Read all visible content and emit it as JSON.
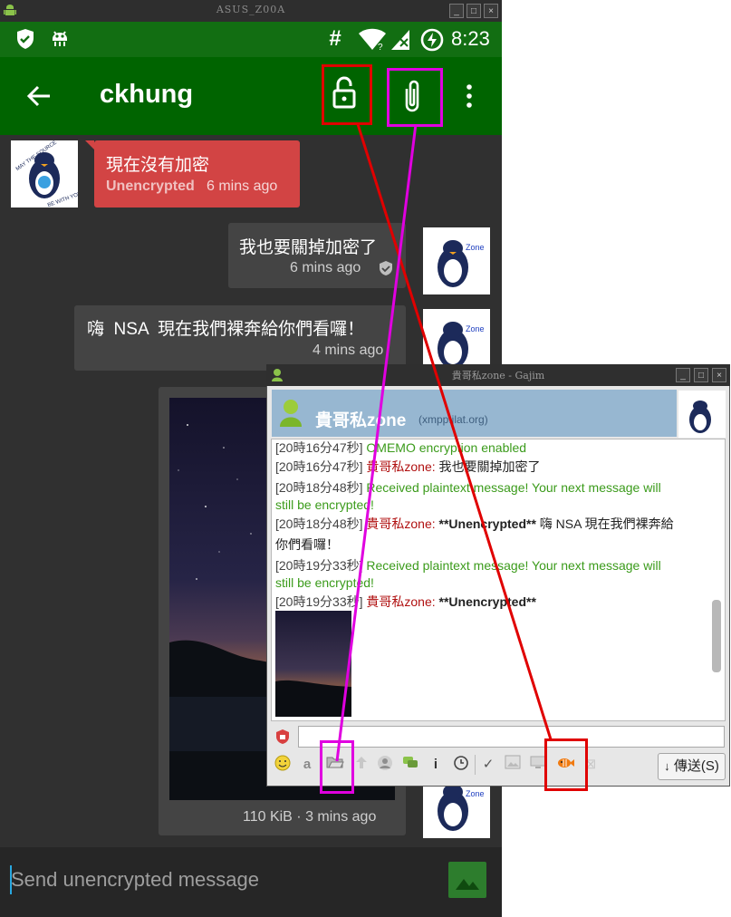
{
  "emulator": {
    "window_title": "ASUS_Z00A",
    "status_time": "8:23",
    "status_icons": [
      "shield-icon",
      "android-debug-icon",
      "hash-icon",
      "wifi-icon",
      "no-sim-icon",
      "battery-saver-icon"
    ]
  },
  "conversations": {
    "contact_name": "ckhung",
    "toolbar": [
      "back-arrow-icon",
      "lock-open-icon",
      "paperclip-icon",
      "overflow-menu-icon"
    ],
    "messages": [
      {
        "side": "left",
        "text": "現在沒有加密",
        "status": "Unencrypted",
        "time": "6 mins ago"
      },
      {
        "side": "right",
        "text": "我也要關掉加密了",
        "time": "6 mins ago"
      },
      {
        "side": "left",
        "text": "嗨  NSA  現在我們裸奔給你們看囉！",
        "time": "4 mins ago"
      },
      {
        "side": "left",
        "type": "image",
        "size_time": "110 KiB · 3 mins ago"
      }
    ],
    "input_placeholder": "Send unencrypted message"
  },
  "gajim": {
    "window_title": "貴哥私zone - Gajim",
    "contact_name": "貴哥私zone",
    "contact_jid": "(xmpp.jlat.org)",
    "log": [
      {
        "ts": "[20時16分47秒]",
        "info": "OMEMO encryption enabled"
      },
      {
        "ts": "[20時16分47秒]",
        "nick": "貴哥私zone:",
        "text": "我也要關掉加密了"
      },
      {
        "ts": "[20時18分48秒]",
        "info": "Received plaintext message! Your next message will",
        "info2": "still be encrypted!"
      },
      {
        "ts": "[20時18分48秒]",
        "nick": "貴哥私zone:",
        "bold": "**Unencrypted**",
        "text": "嗨  NSA  現在我們裸奔給",
        "text2": "你們看囉！"
      },
      {
        "ts": "[20時19分33秒]",
        "info": "Received plaintext message! Your next message will",
        "info2": "still be encrypted!"
      },
      {
        "ts": "[20時19分33秒]",
        "nick": "貴哥私zone:",
        "bold": "**Unencrypted**"
      }
    ],
    "send_button": "傳送(S)",
    "toolbar": [
      "emoji-icon",
      "format-icon",
      "send-file-icon",
      "upload-icon",
      "user-icon",
      "conversation-icon",
      "info-icon",
      "history-icon",
      "check-icon",
      "image-icon",
      "screen-icon",
      "encryption-fish-icon",
      "close-icon"
    ]
  },
  "annotation_colors": {
    "encryption": "#e00000",
    "file_transfer": "#e000e0"
  }
}
